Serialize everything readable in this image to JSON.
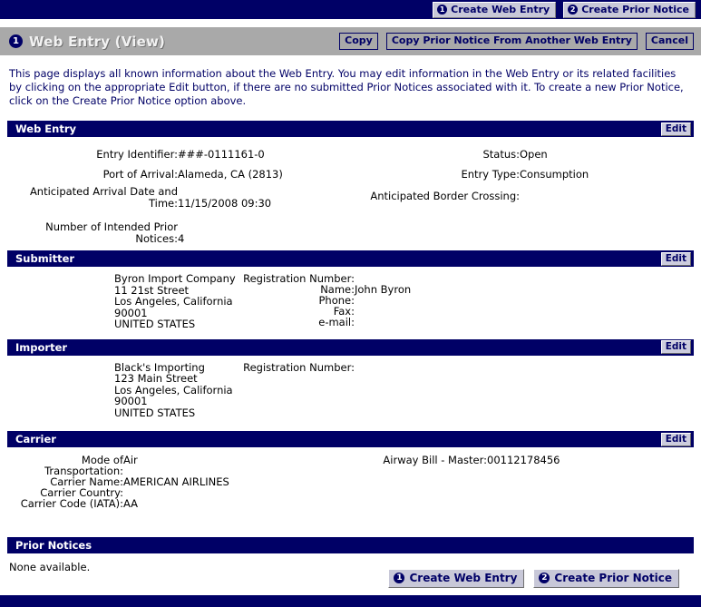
{
  "topnav": {
    "buttons": [
      {
        "num": "❶",
        "label": "Create Web Entry"
      },
      {
        "num": "❷",
        "label": "Create Prior Notice"
      }
    ]
  },
  "titlebar": {
    "num": "1",
    "title": "Web Entry (View)",
    "actions": [
      {
        "label": "Copy"
      },
      {
        "label": "Copy Prior Notice From Another Web Entry"
      },
      {
        "label": "Cancel"
      }
    ]
  },
  "intro": "This page displays all known information about the Web Entry. You may edit information in the Web Entry or its related facilities by clicking on the appropriate Edit button, if there are no submitted Prior Notices associated with it. To create a new Prior Notice, click on the Create Prior Notice option above.",
  "sections": {
    "web_entry": {
      "heading": "Web Entry",
      "edit_label": "Edit",
      "left_fields": [
        {
          "label": "Entry Identifier:",
          "value": "###-0111161-0"
        },
        {
          "label": "Port of Arrival:",
          "value": "Alameda, CA (2813)"
        },
        {
          "label": "Anticipated Arrival Date and Time:",
          "value": "11/15/2008 09:30"
        },
        {
          "label": "Number of Intended Prior Notices:",
          "value": "4"
        }
      ],
      "right_fields": [
        {
          "label": "Status:",
          "value": "Open"
        },
        {
          "label": "Entry Type:",
          "value": "Consumption"
        },
        {
          "label": "Anticipated Border Crossing:",
          "value": ""
        }
      ]
    },
    "submitter": {
      "heading": "Submitter",
      "edit_label": "Edit",
      "address": "Byron Import Company\n11 21st Street\nLos Angeles, California  90001\nUNITED STATES",
      "fields": [
        {
          "label": "Registration Number:",
          "value": ""
        },
        {
          "label": "Name:",
          "value": "John Byron"
        },
        {
          "label": "Phone:",
          "value": ""
        },
        {
          "label": "Fax:",
          "value": ""
        },
        {
          "label": "e-mail:",
          "value": ""
        }
      ]
    },
    "importer": {
      "heading": "Importer",
      "edit_label": "Edit",
      "address": "Black's Importing\n123 Main Street\nLos Angeles, California  90001\nUNITED STATES",
      "fields": [
        {
          "label": "Registration Number:",
          "value": ""
        }
      ]
    },
    "carrier": {
      "heading": "Carrier",
      "edit_label": "Edit",
      "left_fields": [
        {
          "label": "Mode of Transportation:",
          "value": "Air"
        },
        {
          "label": "Carrier Name:",
          "value": "AMERICAN AIRLINES"
        },
        {
          "label": "Carrier Country:",
          "value": ""
        },
        {
          "label": "Carrier Code (IATA):",
          "value": "AA"
        }
      ],
      "right_fields": [
        {
          "label": "Airway Bill - Master:",
          "value": "00112178456"
        }
      ]
    },
    "prior_notices": {
      "heading": "Prior Notices",
      "empty_text": "None available."
    }
  },
  "footer": {
    "buttons": [
      {
        "num": "❶",
        "label": "Create Web Entry"
      },
      {
        "num": "❷",
        "label": "Create Prior Notice"
      }
    ]
  },
  "colors": {
    "navy": "#000066",
    "titlebar_gray": "#a9a9a9",
    "button_face": "#c8c8d8"
  }
}
